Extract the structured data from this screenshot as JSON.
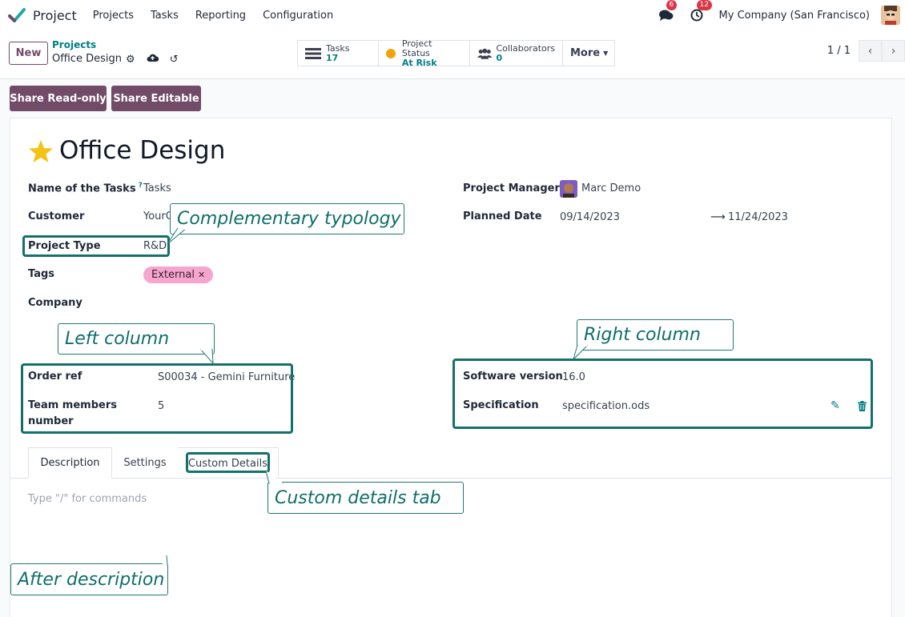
{
  "navbar": {
    "app_name": "Project",
    "menu": [
      "Projects",
      "Tasks",
      "Reporting",
      "Configuration"
    ],
    "messages_count": "6",
    "activities_count": "12",
    "company": "My Company (San Francisco)"
  },
  "control": {
    "new_label": "New",
    "breadcrumb_parent": "Projects",
    "breadcrumb_current": "Office Design",
    "smart_buttons": [
      {
        "label": "Tasks",
        "value": "17"
      },
      {
        "label": "Project Status",
        "value": "At Risk"
      },
      {
        "label": "Collaborators",
        "value": "0"
      }
    ],
    "more_label": "More",
    "pager": "1 / 1"
  },
  "share": {
    "read_only": "Share Read-only",
    "editable": "Share Editable"
  },
  "form": {
    "title": "Office Design",
    "fields": {
      "name_of_tasks_label": "Name of the Tasks",
      "name_of_tasks_help": "?",
      "name_of_tasks_value": "Tasks",
      "customer_label": "Customer",
      "customer_value": "YourC",
      "project_type_label": "Project Type",
      "project_type_value": "R&D",
      "tags_label": "Tags",
      "tag_value": "External",
      "company_label": "Company",
      "project_manager_label": "Project Manager",
      "project_manager_value": "Marc Demo",
      "planned_date_label": "Planned Date",
      "planned_date_start": "09/14/2023",
      "planned_date_end": "11/24/2023",
      "order_ref_label": "Order ref",
      "order_ref_value": "S00034 - Gemini Furniture",
      "team_members_label_line1": "Team members",
      "team_members_label_line2": "number",
      "team_members_value": "5",
      "software_version_label": "Software version",
      "software_version_value": "16.0",
      "specification_label": "Specification",
      "specification_value": "specification.ods"
    },
    "tabs": [
      "Description",
      "Settings",
      "Custom Details"
    ],
    "description_placeholder": "Type \"/\" for commands"
  },
  "callouts": {
    "complementary_typology": "Complementary typology",
    "left_column": "Left column",
    "right_column": "Right column",
    "custom_details_tab": "Custom details tab",
    "after_description": "After description"
  },
  "colors": {
    "brand_purple": "#714b67",
    "accent_teal": "#017e84",
    "callout_teal": "#14706b",
    "badge_red": "#dc3545",
    "tag_pink": "#f6a5cf",
    "star_yellow": "#f3c316"
  }
}
